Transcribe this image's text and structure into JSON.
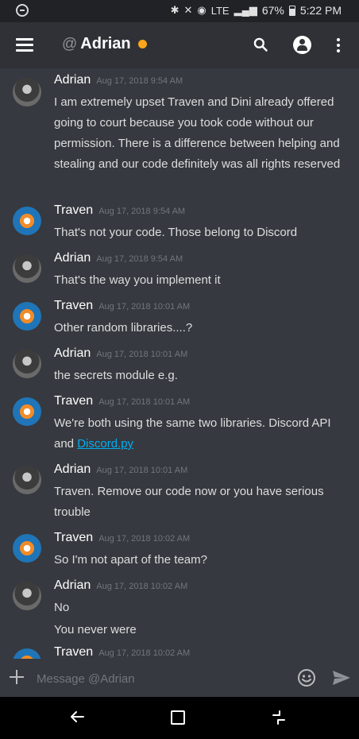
{
  "status_bar": {
    "signal": "LTE",
    "battery": "67%",
    "time": "5:22 PM"
  },
  "header": {
    "at_symbol": "@",
    "channel_name": "Adrian",
    "status_color": "#faa61a"
  },
  "messages": [
    {
      "author": "Adrian",
      "avatar": "adrian-avatar",
      "timestamp": "Aug 17, 2018 9:54 AM",
      "lines": [
        "I am extremely upset Traven and Dini already offered going to court because you took code without our permission. There is a difference between helping and stealing and our code definitely was all rights reserved"
      ]
    },
    {
      "author": "Traven",
      "avatar": "traven-avatar",
      "timestamp": "Aug 17, 2018 9:54 AM",
      "lines": [
        "That's not your code. Those belong to Discord"
      ]
    },
    {
      "author": "Adrian",
      "avatar": "adrian-avatar",
      "timestamp": "Aug 17, 2018 9:54 AM",
      "lines": [
        "That's the way you implement it"
      ]
    },
    {
      "author": "Traven",
      "avatar": "traven-avatar",
      "timestamp": "Aug 17, 2018 10:01 AM",
      "lines": [
        "Other random libraries....?"
      ]
    },
    {
      "author": "Adrian",
      "avatar": "adrian-avatar",
      "timestamp": "Aug 17, 2018 10:01 AM",
      "lines": [
        "the secrets module e.g."
      ]
    },
    {
      "author": "Traven",
      "avatar": "traven-avatar",
      "timestamp": "Aug 17, 2018 10:01 AM",
      "lines": [
        "We're both using the same two libraries. Discord API and "
      ],
      "link": "Discord.py"
    },
    {
      "author": "Adrian",
      "avatar": "adrian-avatar",
      "timestamp": "Aug 17, 2018 10:01 AM",
      "lines": [
        "Traven. Remove our code now or you have serious trouble"
      ]
    },
    {
      "author": "Traven",
      "avatar": "traven-avatar",
      "timestamp": "Aug 17, 2018 10:02 AM",
      "lines": [
        "So I'm not apart of the team?"
      ]
    },
    {
      "author": "Adrian",
      "avatar": "adrian-avatar",
      "timestamp": "Aug 17, 2018 10:02 AM",
      "lines": [
        "No",
        "You never were"
      ]
    },
    {
      "author": "Traven",
      "avatar": "traven-avatar",
      "timestamp": "Aug 17, 2018 10:02 AM",
      "lines": []
    }
  ],
  "composer": {
    "placeholder": "Message @Adrian"
  },
  "colors": {
    "background": "#36393f",
    "header": "#2f3136",
    "link": "#00b0f4",
    "idle": "#faa61a"
  }
}
